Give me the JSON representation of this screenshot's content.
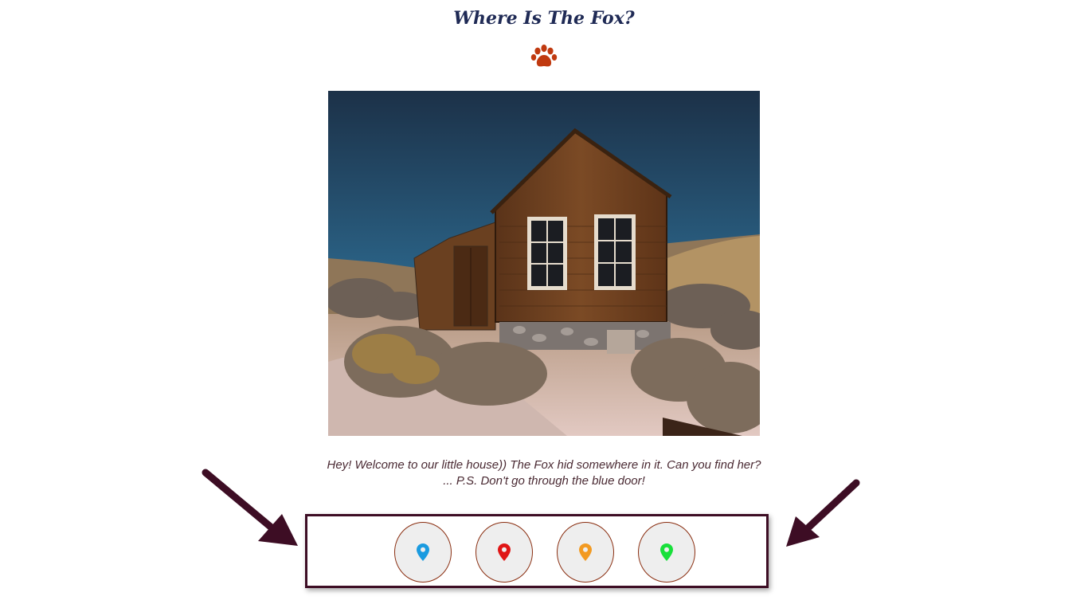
{
  "header": {
    "title": "Where Is The Fox?",
    "logo_icon": "paw-icon",
    "logo_color": "#c0390f"
  },
  "scene": {
    "image": "abandoned-wooden-house-scene"
  },
  "caption": {
    "text": "Hey! Welcome to our little house)) The Fox hid somewhere in it. Can you find her? ... P.S. Don't go through the blue door!"
  },
  "location_buttons": [
    {
      "icon": "map-pin-icon",
      "color": "#1a9be0"
    },
    {
      "icon": "map-pin-icon",
      "color": "#e01515"
    },
    {
      "icon": "map-pin-icon",
      "color": "#f29a22"
    },
    {
      "icon": "map-pin-icon",
      "color": "#18e03a"
    }
  ],
  "colors": {
    "title": "#1f2a55",
    "frame": "#3d0d24",
    "button_border": "#8a2e10",
    "arrow": "#3d0d24"
  }
}
